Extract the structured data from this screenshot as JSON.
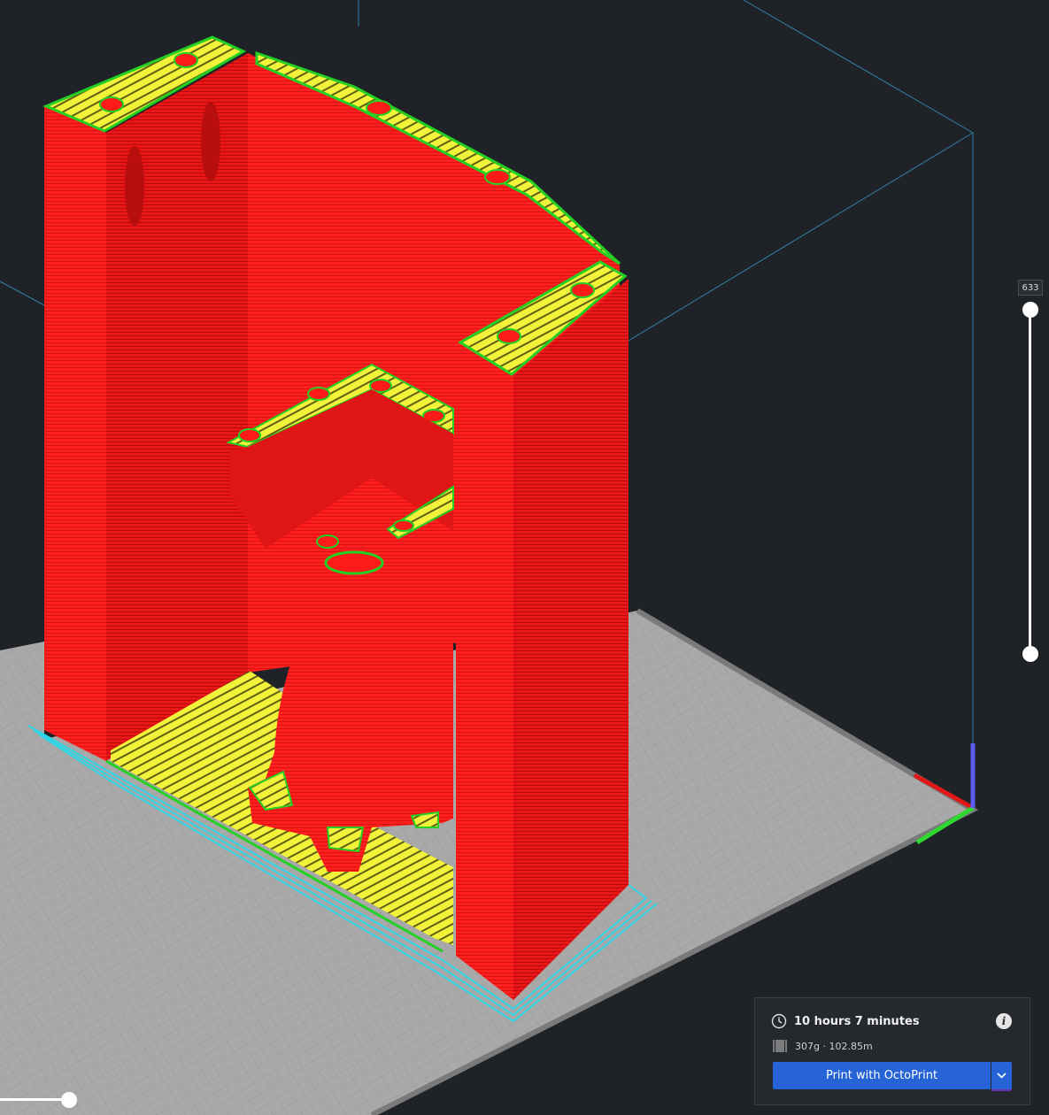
{
  "colors": {
    "background": "#1f2226",
    "build_plate": "#a8a8a8",
    "wall": "#ff1a1a",
    "infill": "#f2f23a",
    "inner_wall": "#23d023",
    "skirt": "#2fd6e6",
    "accent": "#2563d6"
  },
  "layer_slider": {
    "current_layer": "633"
  },
  "print_info": {
    "time": "10 hours 7 minutes",
    "material": "307g · 102.85m",
    "info_icon": "i",
    "time_icon": "clock-icon",
    "material_icon": "spool-icon"
  },
  "print_button": {
    "label": "Print with OctoPrint",
    "dropdown_icon": "chevron-down-icon"
  }
}
